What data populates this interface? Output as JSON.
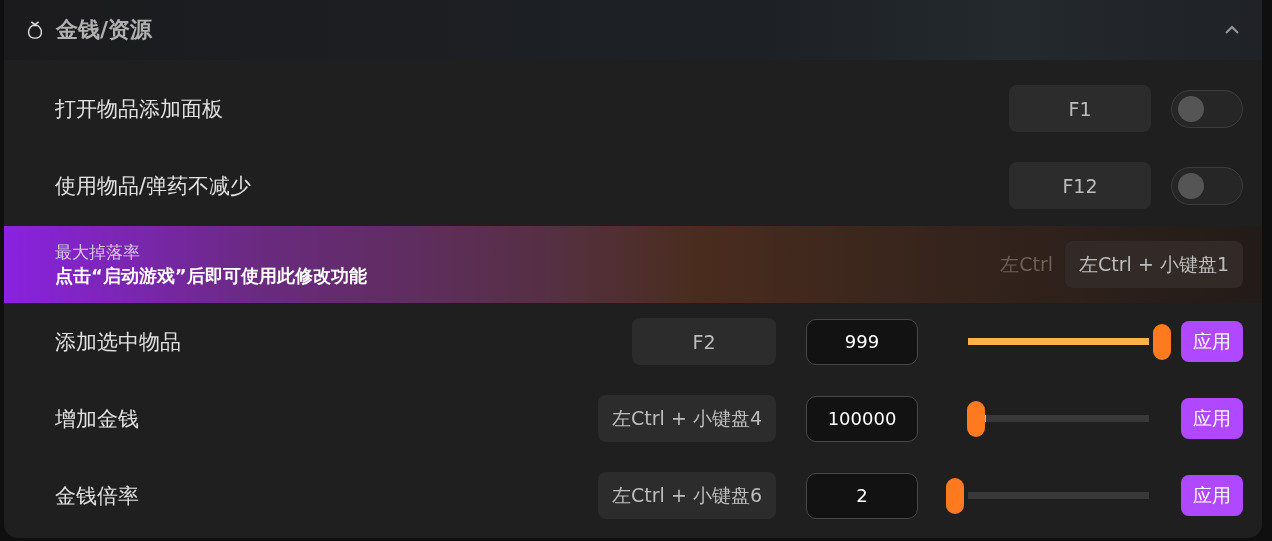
{
  "section": {
    "title": "金钱/资源",
    "expanded": true
  },
  "rows": [
    {
      "kind": "toggle",
      "label": "打开物品添加面板",
      "key": "F1",
      "on": false
    },
    {
      "kind": "toggle",
      "label": "使用物品/弹药不减少",
      "key": "F12",
      "on": false
    },
    {
      "kind": "banner",
      "title": "最大掉落率",
      "message": "点击“启动游戏”后即可使用此修改功能",
      "ghost_key": "左Ctrl",
      "key": "左Ctrl + 小键盘1"
    },
    {
      "kind": "slider",
      "label": "添加选中物品",
      "key": "F2",
      "value": "999",
      "level": 1,
      "button": "应用"
    },
    {
      "kind": "slider",
      "label": "增加金钱",
      "key": "左Ctrl + 小键盘4",
      "value": "100000",
      "level": 0.1,
      "button": "应用"
    },
    {
      "kind": "slider",
      "label": "金钱倍率",
      "key": "左Ctrl + 小键盘6",
      "value": "2",
      "level": 0,
      "button": "应用"
    }
  ]
}
